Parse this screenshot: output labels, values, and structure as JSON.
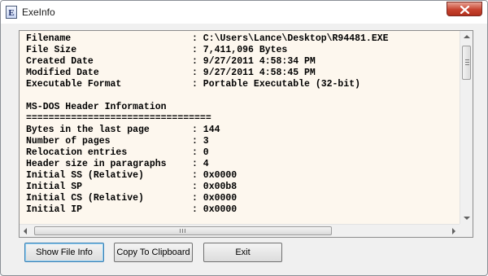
{
  "window": {
    "title": "ExeInfo",
    "app_icon_glyph": "E"
  },
  "content": {
    "lines": [
      {
        "label": "Filename",
        "value": ": C:\\Users\\Lance\\Desktop\\R94481.EXE"
      },
      {
        "label": "File Size",
        "value": ": 7,411,096 Bytes"
      },
      {
        "label": "Created Date",
        "value": ": 9/27/2011 4:58:34 PM"
      },
      {
        "label": "Modified Date",
        "value": ": 9/27/2011 4:58:45 PM"
      },
      {
        "label": "Executable Format",
        "value": ": Portable Executable (32-bit)"
      },
      {
        "label": "",
        "value": ""
      },
      {
        "label": "MS-DOS Header Information",
        "value": ""
      },
      {
        "label": "=================================",
        "value": ""
      },
      {
        "label": "Bytes in the last page",
        "value": ": 144"
      },
      {
        "label": "Number of pages",
        "value": ": 3"
      },
      {
        "label": "Relocation entries",
        "value": ": 0"
      },
      {
        "label": "Header size in paragraphs",
        "value": ": 4"
      },
      {
        "label": "Initial SS (Relative)",
        "value": ": 0x0000"
      },
      {
        "label": "Initial SP",
        "value": ": 0x00b8"
      },
      {
        "label": "Initial CS (Relative)",
        "value": ": 0x0000"
      },
      {
        "label": "Initial IP",
        "value": ": 0x0000"
      }
    ]
  },
  "buttons": {
    "show_file_info": "Show File Info",
    "copy_to_clipboard": "Copy To Clipboard",
    "exit": "Exit"
  },
  "colors": {
    "text_background": "#fdf7ee",
    "close_button": "#c7432f",
    "default_button_border": "#3c7fb1"
  },
  "icons": {
    "close": "close-x-icon",
    "app": "exeinfo-app-icon"
  }
}
